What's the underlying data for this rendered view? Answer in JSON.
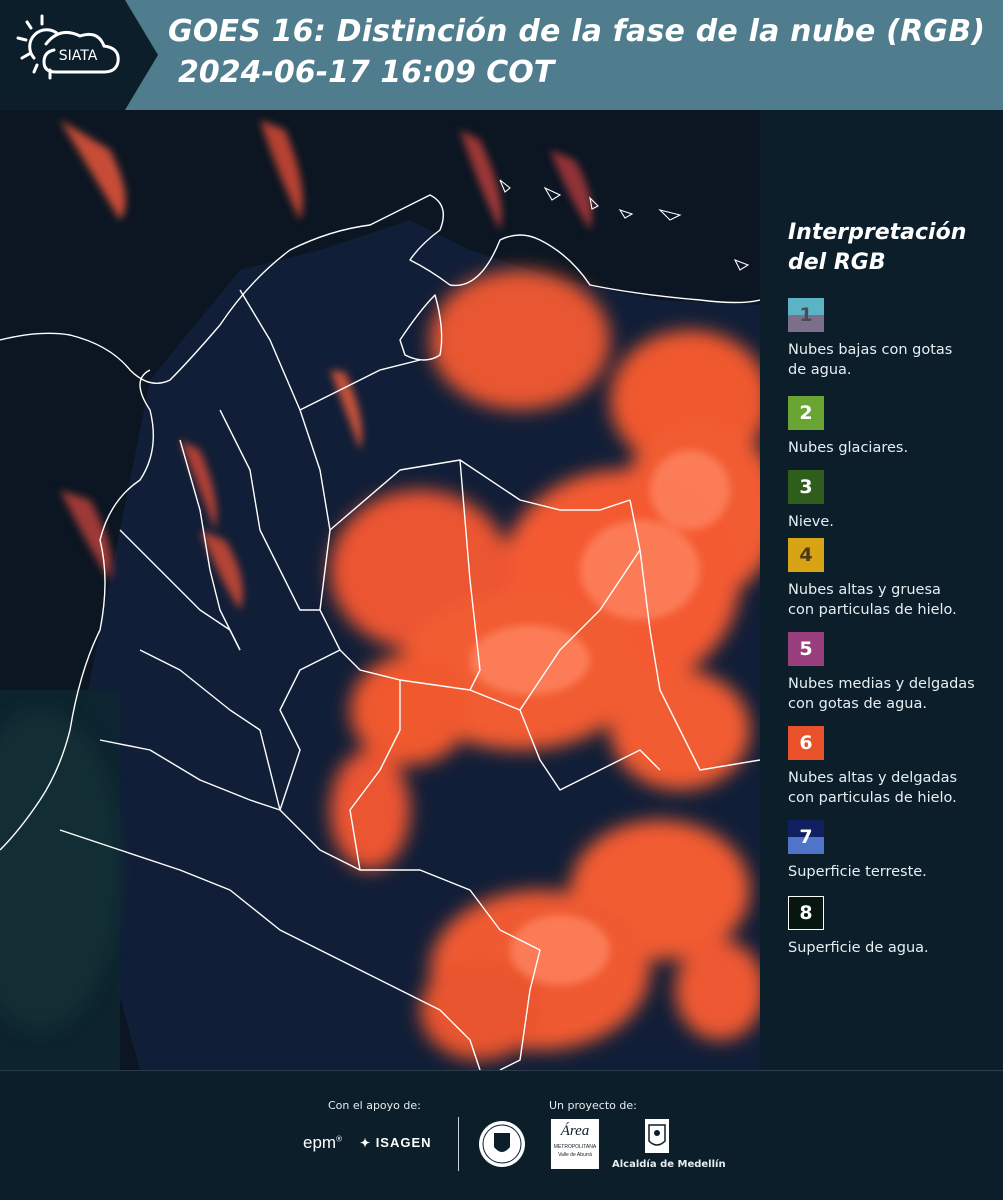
{
  "header": {
    "logo_text": "SIATA",
    "title_line1": "GOES 16: Distinción de la fase de la nube (RGB)",
    "title_line2": "2024-06-17 16:09 COT"
  },
  "legend": {
    "title_line1": "Interpretación",
    "title_line2": "del RGB",
    "items": [
      {
        "num": "1",
        "top": "#5bb3c4",
        "bottom": "#7b6f8c",
        "num_color": "#4a4a5a",
        "line1": "Nubes bajas con gotas",
        "line2": "de agua."
      },
      {
        "num": "2",
        "top": "#6aa533",
        "bottom": "#6aa533",
        "num_color": "#ffffff",
        "line1": "Nubes glaciares.",
        "line2": ""
      },
      {
        "num": "3",
        "top": "#2f5d1c",
        "bottom": "#2f5d1c",
        "num_color": "#ffffff",
        "line1": "Nieve.",
        "line2": ""
      },
      {
        "num": "4",
        "top": "#d9a316",
        "bottom": "#d9a316",
        "num_color": "#4a3a10",
        "line1": "Nubes altas y gruesa",
        "line2": "con particulas de hielo."
      },
      {
        "num": "5",
        "top": "#9a3f7e",
        "bottom": "#9a3f7e",
        "num_color": "#ffffff",
        "line1": "Nubes medias y delgadas",
        "line2": "con gotas de agua."
      },
      {
        "num": "6",
        "top": "#e8512a",
        "bottom": "#e8512a",
        "num_color": "#ffffff",
        "line1": "Nubes altas y delgadas",
        "line2": "con particulas de hielo."
      },
      {
        "num": "7",
        "top": "#101f60",
        "bottom": "#4f74c9",
        "num_color": "#ffffff",
        "line1": "Superficie terreste.",
        "line2": ""
      },
      {
        "num": "8",
        "top": "#07160e",
        "bottom": "#07160e",
        "num_color": "#ffffff",
        "line1": "Superficie de agua.",
        "line2": ""
      }
    ]
  },
  "footer": {
    "support_label": "Con el apoyo de:",
    "project_label": "Un proyecto de:",
    "epm": "epm",
    "isagen": "ISAGEN",
    "area_name": "Área",
    "area_sub1": "METROPOLITANA",
    "area_sub2": "Valle de Aburrá",
    "alcaldia": "Alcaldía de Medellín"
  }
}
